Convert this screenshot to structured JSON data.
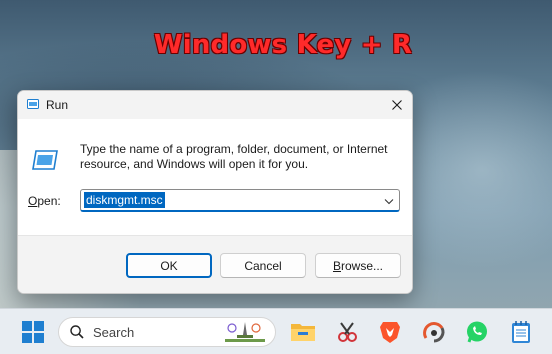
{
  "overlay_caption": "Windows Key + R",
  "dialog": {
    "title": "Run",
    "description": "Type the name of a program, folder, document, or Internet resource, and Windows will open it for you.",
    "open_label_prefix": "O",
    "open_label_rest": "pen:",
    "input_value": "diskmgmt.msc",
    "ok_label": "OK",
    "cancel_label": "Cancel",
    "browse_label_prefix": "B",
    "browse_label_rest": "rowse..."
  },
  "taskbar": {
    "search_placeholder": "Search",
    "apps": [
      "file-explorer-icon",
      "snipping-tool-icon",
      "brave-browser-icon",
      "app-icon",
      "whatsapp-icon",
      "notepad-icon"
    ]
  },
  "colors": {
    "caption": "#ff2a2a",
    "accent": "#0067c0",
    "titlebar": "#f3f3f3",
    "taskbar": "#e8edf2"
  }
}
